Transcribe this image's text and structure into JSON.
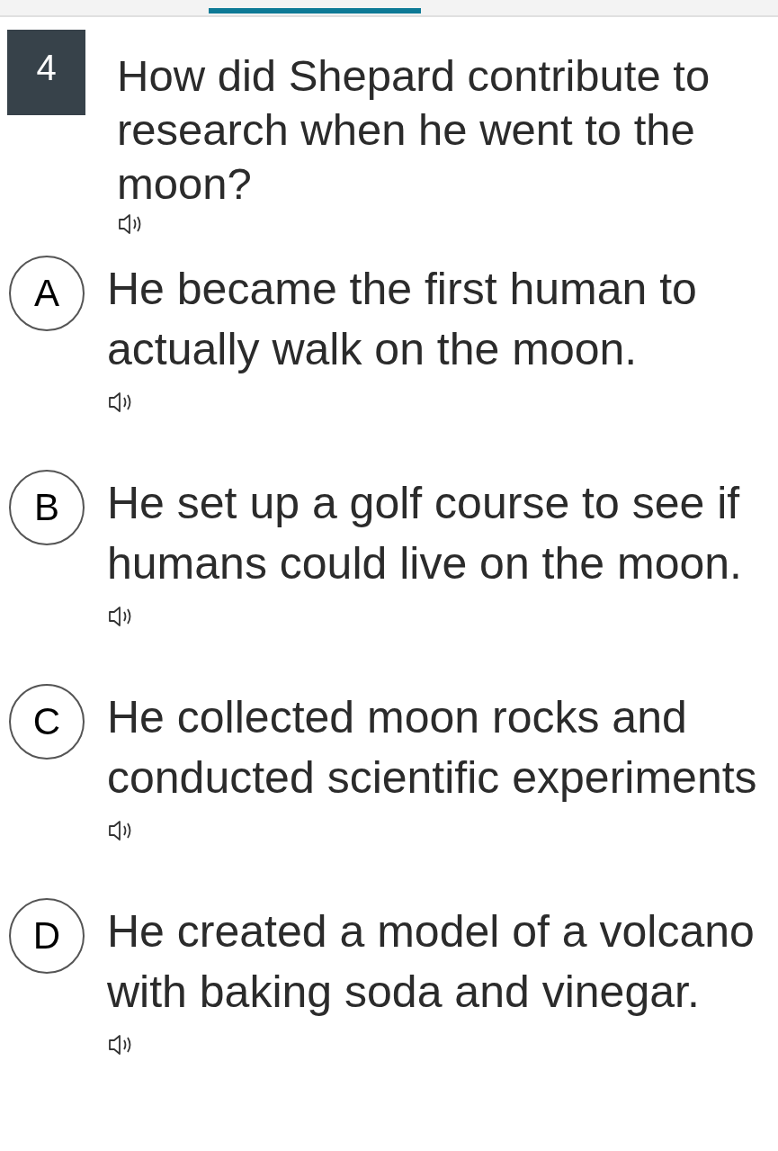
{
  "question": {
    "number": "4",
    "text": "How did Shepard contribute to research when he went to the moon?"
  },
  "options": [
    {
      "letter": "A",
      "text": "He became the first human to actually walk on the moon."
    },
    {
      "letter": "B",
      "text": "He set up a golf course to see if humans could live on the moon."
    },
    {
      "letter": "C",
      "text": "He collected moon rocks and conducted scientific experiments"
    },
    {
      "letter": "D",
      "text": "He created a model of a volcano with baking soda and vinegar."
    }
  ]
}
